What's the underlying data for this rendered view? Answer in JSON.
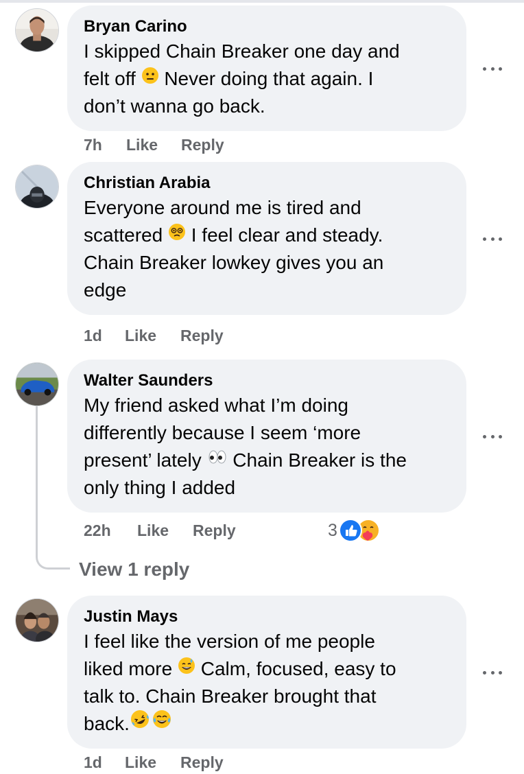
{
  "comments": [
    {
      "author": "Bryan Carino",
      "lines": [
        "I skipped Chain Breaker one day and",
        "felt off",
        "Never doing that again. I",
        "don’t wanna go back."
      ],
      "emoji": [
        "neutral-face"
      ],
      "time": "7h",
      "like": "Like",
      "reply": "Reply"
    },
    {
      "author": "Christian Arabia",
      "lines": [
        "Everyone around me is tired and",
        "scattered",
        "I feel clear and steady.",
        "Chain Breaker lowkey gives you an",
        "edge"
      ],
      "emoji": [
        "dizzy-face"
      ],
      "time": "1d",
      "like": "Like",
      "reply": "Reply"
    },
    {
      "author": "Walter Saunders",
      "lines": [
        "My friend asked what I’m doing",
        "differently because I seem ‘more",
        "present’ lately",
        "Chain Breaker is the",
        "only thing I added"
      ],
      "emoji": [
        "eyes"
      ],
      "time": "22h",
      "like": "Like",
      "reply": "Reply",
      "reaction_count": "3",
      "reactions": [
        "like-reaction",
        "care-reaction"
      ],
      "view_replies": "View 1 reply"
    },
    {
      "author": "Justin Mays",
      "lines": [
        "I feel like the version of me people",
        "liked more",
        "Calm, focused, easy to",
        "talk to. Chain Breaker brought that",
        "back."
      ],
      "emoji": [
        "grinning-sweat-face",
        "rolling-laughing-face",
        "tears-of-joy-face"
      ],
      "time": "1d",
      "like": "Like",
      "reply": "Reply"
    }
  ],
  "colors": {
    "bubble": "#f0f2f5",
    "meta_text": "#65676b",
    "like_blue": "#1877f2",
    "thread_line": "#ced0d4"
  }
}
